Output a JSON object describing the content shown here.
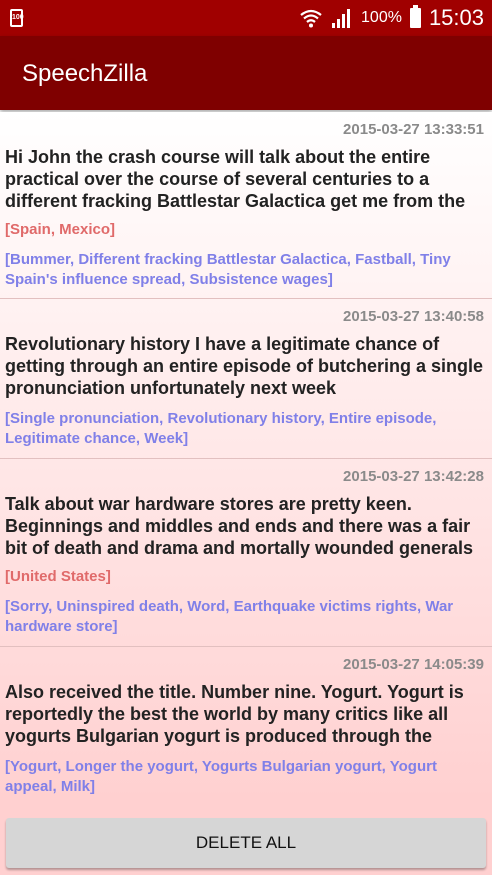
{
  "status_bar": {
    "sim_label": "100",
    "battery_percent": "100%",
    "time": "15:03"
  },
  "app_bar": {
    "title": "SpeechZilla"
  },
  "entries": [
    {
      "timestamp": "2015-03-27 13:33:51",
      "text": "Hi John the crash course will talk about the entire practical over the course of several centuries to a different fracking Battlestar Galactica get me from the",
      "places": "[Spain, Mexico]",
      "keywords": "[Bummer, Different fracking Battlestar Galactica, Fastball, Tiny Spain's influence spread, Subsistence wages]"
    },
    {
      "timestamp": "2015-03-27 13:40:58",
      "text": "Revolutionary history I have a legitimate chance of getting through an entire episode of butchering a single pronunciation unfortunately next week",
      "places": "",
      "keywords": "[Single pronunciation, Revolutionary history, Entire episode, Legitimate chance, Week]"
    },
    {
      "timestamp": "2015-03-27 13:42:28",
      "text": "Talk about war hardware stores are pretty keen. Beginnings and middles and ends and there was a fair bit of death and drama and mortally wounded generals",
      "places": "[United States]",
      "keywords": "[Sorry, Uninspired death, Word, Earthquake victims rights, War hardware store]"
    },
    {
      "timestamp": "2015-03-27 14:05:39",
      "text": "Also received the title. Number nine. Yogurt. Yogurt is reportedly the best the world by many critics like all yogurts Bulgarian yogurt is produced through the",
      "places": "",
      "keywords": "[Yogurt, Longer the yogurt, Yogurts Bulgarian yogurt, Yogurt appeal, Milk]"
    }
  ],
  "footer": {
    "delete_all_label": "DELETE ALL"
  }
}
